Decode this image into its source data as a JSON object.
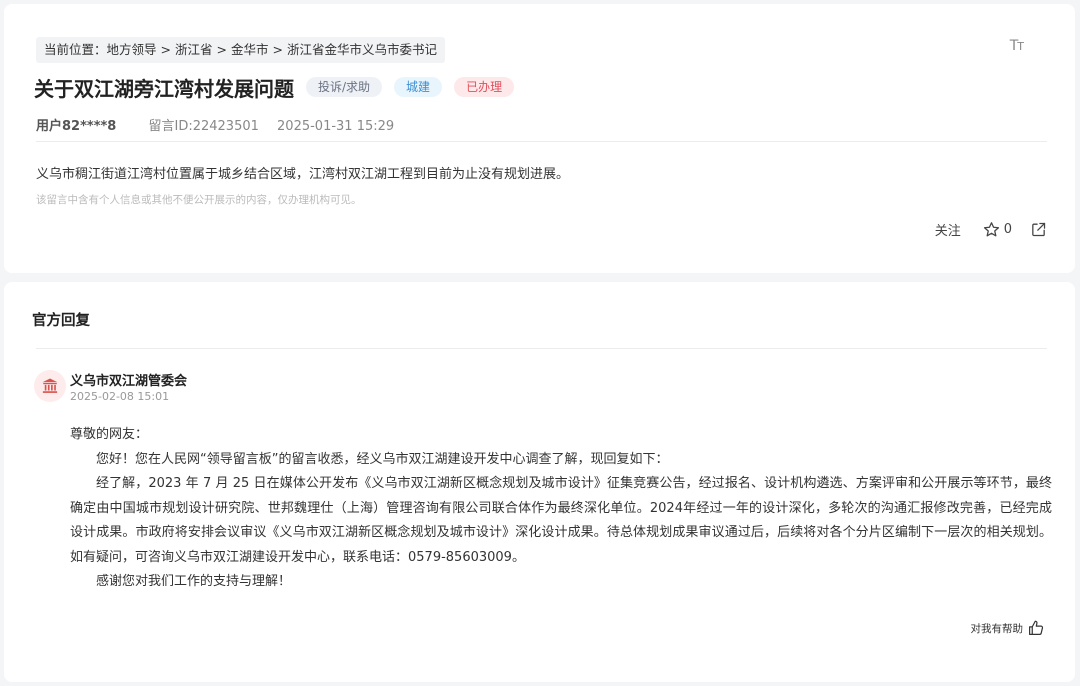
{
  "breadcrumb": {
    "prefix": "当前位置：",
    "items": [
      "地方领导",
      "浙江省",
      "金华市",
      "浙江省金华市义乌市委书记"
    ],
    "separator": ">"
  },
  "font_size_icon": "Tт",
  "message": {
    "title": "关于双江湖旁江湾村发展问题",
    "tags": {
      "type": "投诉/求助",
      "field": "城建",
      "status": "已办理"
    },
    "user": "用户82****8",
    "message_id": "留言ID:22423501",
    "datetime": "2025-01-31 15:29",
    "content": "义乌市稠江街道江湾村位置属于城乡结合区域，江湾村双江湖工程到目前为止没有规划进展。",
    "privacy_note": "该留言中含有个人信息或其他不便公开展示的内容，仅办理机构可见。"
  },
  "actions": {
    "follow_label": "关注",
    "star_count": "0"
  },
  "reply": {
    "section_title": "官方回复",
    "org_name": "义乌市双江湖管委会",
    "org_time": "2025-02-08 15:01",
    "greeting": "尊敬的网友：",
    "para1": "您好！您在人民网“领导留言板”的留言收悉，经义乌市双江湖建设开发中心调查了解，现回复如下：",
    "para2": "经了解，2023 年 7 月 25 日在媒体公开发布《义乌市双江湖新区概念规划及城市设计》征集竞赛公告，经过报名、设计机构遴选、方案评审和公开展示等环节，最终确定由中国城市规划设计研究院、世邦魏理仕（上海）管理咨询有限公司联合体作为最终深化单位。2024年经过一年的设计深化，多轮次的沟通汇报修改完善，已经完成设计成果。市政府将安排会议审议《义乌市双江湖新区概念规划及城市设计》深化设计成果。待总体规划成果审议通过后，后续将对各个分片区编制下一层次的相关规划。如有疑问，可咨询义乌市双江湖建设开发中心，联系电话：0579-85603009。",
    "para3": "感谢您对我们工作的支持与理解！",
    "helpful_label": "对我有帮助"
  },
  "colors": {
    "status_tag": "#e0515d",
    "field_tag": "#3a8fd3",
    "avatar_icon": "#d9534f"
  }
}
